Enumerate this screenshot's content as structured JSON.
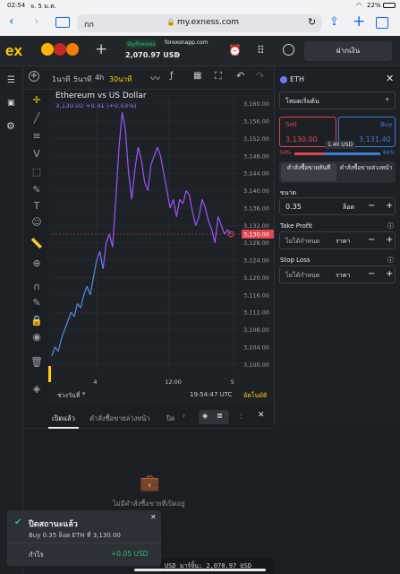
{
  "status": {
    "time": "02:54",
    "date": "จ. 5 ม.ค.",
    "battery": "22%"
  },
  "safari": {
    "aa": "กก",
    "url": "my.exness.com"
  },
  "header": {
    "logo": "ex",
    "account_label": "บัญชีทดลอง",
    "account_server": "forexonapp.com",
    "balance": "2,070.97 USD",
    "deposit_label": "ฝากเงิน"
  },
  "chart_toolbar": {
    "tf1": "1นาที",
    "tf2": "5นาที",
    "tf3": "4h",
    "tf4": "30นาที"
  },
  "chart": {
    "title": "Ethereum vs US Dollar",
    "quote": "3,130.00 +0.81 (+0.03%)",
    "period_label": "ช่วงวันที่",
    "clock": "19:54:47 UTC",
    "auto_label": "อัตโนมัติ",
    "price_tag": "3,130.00",
    "brand_color": "#ffcf00"
  },
  "chart_data": {
    "type": "line",
    "x_ticks": [
      "4",
      "12:00",
      "5"
    ],
    "y_ticks": [
      3160,
      3156,
      3152,
      3148,
      3144,
      3140,
      3136,
      3132,
      3128,
      3124,
      3120,
      3116,
      3112,
      3108,
      3104,
      3100
    ],
    "ylim": [
      3098,
      3162
    ],
    "series": [
      {
        "values": [
          3102,
          3104,
          3103,
          3106,
          3108,
          3110,
          3112,
          3111,
          3114,
          3113,
          3116,
          3118,
          3116,
          3120,
          3124,
          3126,
          3122,
          3128,
          3130,
          3127,
          3138,
          3150,
          3158,
          3154,
          3144,
          3138,
          3145,
          3150,
          3147,
          3142,
          3140,
          3146,
          3148,
          3150,
          3148,
          3144,
          3140,
          3136,
          3138,
          3134,
          3138,
          3137,
          3140,
          3139,
          3135,
          3132,
          3134,
          3138,
          3136,
          3133,
          3131,
          3128,
          3134,
          3132,
          3130,
          3131,
          3130
        ]
      }
    ],
    "line_color_low": "#4d8fe8",
    "line_color_high": "#9b55ff"
  },
  "order_panel": {
    "symbol": "ETH",
    "mode": "โหมดเริ่มต้น",
    "sell_label": "Sell",
    "sell_price": "3,130.00",
    "buy_label": "Buy",
    "buy_price": "3,131.40",
    "spread": "1.40 USD",
    "sell_pct": "34%",
    "buy_pct": "66%",
    "sell_pct_value": 0.34,
    "tab_market": "คำสั่งซื้อขายทันที",
    "tab_pending": "คำสั่งซื้อขายล่วงหน้า",
    "volume_label": "ขนาด",
    "volume_value": "0.35",
    "volume_unit": "ล็อต",
    "tp_label": "Take Profit",
    "tp_value": "ไม่ได้กำหนด",
    "tp_unit": "ราคา",
    "sl_label": "Stop Loss",
    "sl_value": "ไม่ได้กำหนด",
    "sl_unit": "ราคา"
  },
  "bottom": {
    "tab_open": "เปิดแล้ว",
    "tab_pending": "คำสั่งซื้อขายล่วงหน้า",
    "tab_closed": "ปิด",
    "empty_text": "ไม่มีคำสั่งซื้อขายที่เปิดอยู่"
  },
  "toast": {
    "title": "ปิดสถานะแล้ว",
    "detail": "Buy 0.35 ล็อต ETH ที่ 3,130.00",
    "profit_label": "กำไร",
    "profit_value": "+0.05 USD"
  },
  "footer": {
    "text": "USD  มาร์จิ้น: 2,070.97 USD"
  }
}
